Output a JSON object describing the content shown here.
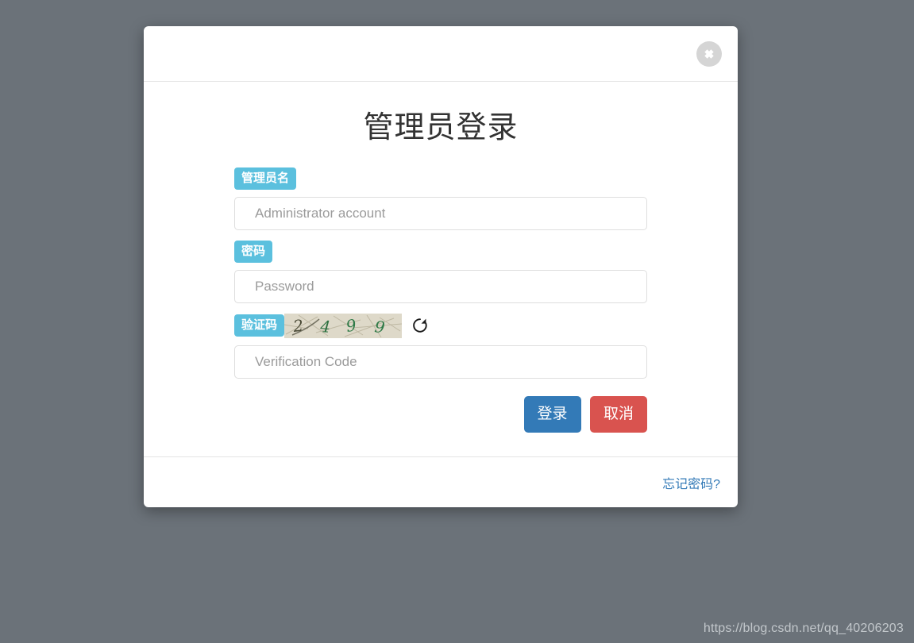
{
  "background_color": "#6b7279",
  "dialog": {
    "title": "管理员登录",
    "close_icon": "close-circle-icon",
    "fields": [
      {
        "key": "admin_name",
        "label": "管理员名",
        "placeholder": "Administrator account",
        "value": "",
        "type": "text"
      },
      {
        "key": "password",
        "label": "密码",
        "placeholder": "Password",
        "value": "",
        "type": "password"
      },
      {
        "key": "verify_code",
        "label": "验证码",
        "placeholder": "Verification Code",
        "value": "",
        "type": "text"
      }
    ],
    "captcha": {
      "text": "2499",
      "characters": [
        "2",
        "4",
        "9",
        "9"
      ],
      "background_color": "#ded9c9",
      "text_color": "#2d6b3f",
      "refresh_icon": "refresh-icon"
    },
    "buttons": {
      "submit_label": "登录",
      "submit_color": "#337ab7",
      "cancel_label": "取消",
      "cancel_color": "#d9534f"
    },
    "footer": {
      "forgot_password_label": "忘记密码?",
      "link_color": "#337ab7"
    },
    "label_badge_color": "#5bc0de"
  },
  "watermark": "https://blog.csdn.net/qq_40206203"
}
